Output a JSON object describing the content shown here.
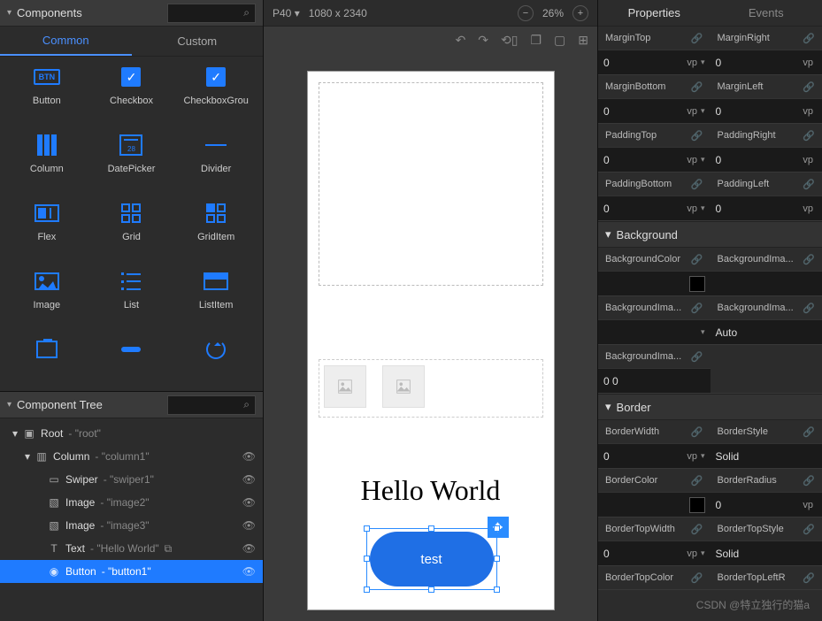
{
  "left": {
    "componentsTitle": "Components",
    "tabs": {
      "common": "Common",
      "custom": "Custom"
    },
    "items": [
      {
        "label": "Button"
      },
      {
        "label": "Checkbox"
      },
      {
        "label": "CheckboxGrou"
      },
      {
        "label": "Column"
      },
      {
        "label": "DatePicker"
      },
      {
        "label": "Divider"
      },
      {
        "label": "Flex"
      },
      {
        "label": "Grid"
      },
      {
        "label": "GridItem"
      },
      {
        "label": "Image"
      },
      {
        "label": "List"
      },
      {
        "label": "ListItem"
      }
    ],
    "treeTitle": "Component Tree",
    "tree": {
      "root": {
        "name": "Root",
        "id": "- \"root\""
      },
      "column": {
        "name": "Column",
        "id": "- \"column1\""
      },
      "swiper": {
        "name": "Swiper",
        "id": "- \"swiper1\""
      },
      "image1": {
        "name": "Image",
        "id": "- \"image2\""
      },
      "image2": {
        "name": "Image",
        "id": "- \"image3\""
      },
      "text": {
        "name": "Text",
        "id": "- \"Hello World\""
      },
      "button": {
        "name": "Button",
        "id": "- \"button1\""
      }
    }
  },
  "center": {
    "device": "P40",
    "dims": "1080 x 2340",
    "zoom": "26%",
    "hello": "Hello World",
    "btn": "test",
    "datenum": "28"
  },
  "right": {
    "tabs": {
      "props": "Properties",
      "events": "Events"
    },
    "sections": {
      "bg": "Background",
      "border": "Border"
    },
    "p": {
      "marginTop": {
        "l": "MarginTop",
        "v": "0",
        "u": "vp"
      },
      "marginRight": {
        "l": "MarginRight",
        "v": "0",
        "u": "vp"
      },
      "marginBottom": {
        "l": "MarginBottom",
        "v": "0",
        "u": "vp"
      },
      "marginLeft": {
        "l": "MarginLeft",
        "v": "0",
        "u": "vp"
      },
      "paddingTop": {
        "l": "PaddingTop",
        "v": "0",
        "u": "vp"
      },
      "paddingRight": {
        "l": "PaddingRight",
        "v": "0",
        "u": "vp"
      },
      "paddingBottom": {
        "l": "PaddingBottom",
        "v": "0",
        "u": "vp"
      },
      "paddingLeft": {
        "l": "PaddingLeft",
        "v": "0",
        "u": "vp"
      },
      "bgColor": {
        "l": "BackgroundColor"
      },
      "bgImgA": {
        "l": "BackgroundIma..."
      },
      "bgImgB": {
        "l": "BackgroundIma..."
      },
      "bgImgC": {
        "l": "BackgroundIma...",
        "v": "Auto"
      },
      "bgImgD": {
        "l": "BackgroundIma...",
        "v": "0 0"
      },
      "borderWidth": {
        "l": "BorderWidth",
        "v": "0",
        "u": "vp"
      },
      "borderStyle": {
        "l": "BorderStyle",
        "v": "Solid"
      },
      "borderColor": {
        "l": "BorderColor"
      },
      "borderRadius": {
        "l": "BorderRadius",
        "v": "0",
        "u": "vp"
      },
      "borderTopWidth": {
        "l": "BorderTopWidth",
        "v": "0",
        "u": "vp"
      },
      "borderTopStyle": {
        "l": "BorderTopStyle",
        "v": "Solid"
      },
      "borderTopColor": {
        "l": "BorderTopColor"
      },
      "borderTopLeft": {
        "l": "BorderTopLeftR"
      }
    }
  },
  "watermark": "CSDN @特立独行的猫a"
}
